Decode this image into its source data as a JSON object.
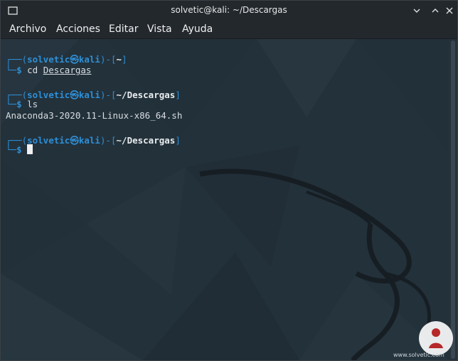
{
  "window": {
    "title": "solvetic@kali: ~/Descargas"
  },
  "menu": {
    "items": [
      "Archivo",
      "Acciones",
      "Editar",
      "Vista",
      "Ayuda"
    ]
  },
  "terminal": {
    "user": "solvetic",
    "host_symbol": "㉿",
    "host": "kali",
    "block1": {
      "dir": "~",
      "command_prefix": "cd ",
      "command_arg": "Descargas"
    },
    "block2": {
      "dir": "~/Descargas",
      "command": "ls",
      "output": "Anaconda3-2020.11-Linux-x86_64.sh"
    },
    "block3": {
      "dir": "~/Descargas"
    },
    "prompt_symbol": "$"
  },
  "colors": {
    "prompt_blue": "#2e8fd6",
    "background": "#23313a"
  },
  "icons": {
    "window_icon": "terminal-window-icon",
    "minimize": "minimize-icon",
    "maximize": "maximize-icon",
    "close": "close-icon"
  },
  "watermark": {
    "text": "www.solvetic.com"
  }
}
